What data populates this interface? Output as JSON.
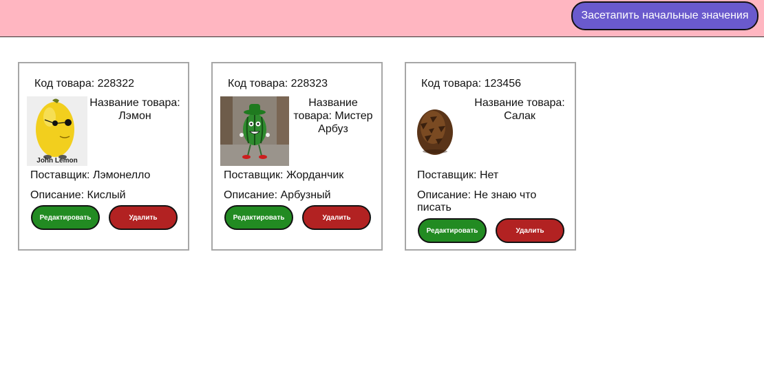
{
  "header": {
    "seed_button_label": "Засетапить начальные значения"
  },
  "colors": {
    "header_bg": "#ffb6c1",
    "seed_button": "#6a5acd",
    "edit_button": "#228b22",
    "delete_button": "#b22222"
  },
  "products": [
    {
      "code": "Код товара: 228322",
      "name": "Название товара: Лэмон",
      "supplier": "Поставщик: Лэмонелло",
      "description": "Описание: Кислый",
      "image_caption": "John Lemon",
      "edit_label": "Редактировать",
      "delete_label": "Удалить"
    },
    {
      "code": "Код товара: 228323",
      "name": "Название товара: Мистер Арбуз",
      "supplier": "Поставщик: Жорданчик",
      "description": "Описание: Арбузный",
      "edit_label": "Редактировать",
      "delete_label": "Удалить"
    },
    {
      "code": "Код товара: 123456",
      "name": "Название товара: Салак",
      "supplier": "Поставщик: Нет",
      "description": "Описание: Не знаю что писать",
      "edit_label": "Редактировать",
      "delete_label": "Удалить"
    }
  ]
}
